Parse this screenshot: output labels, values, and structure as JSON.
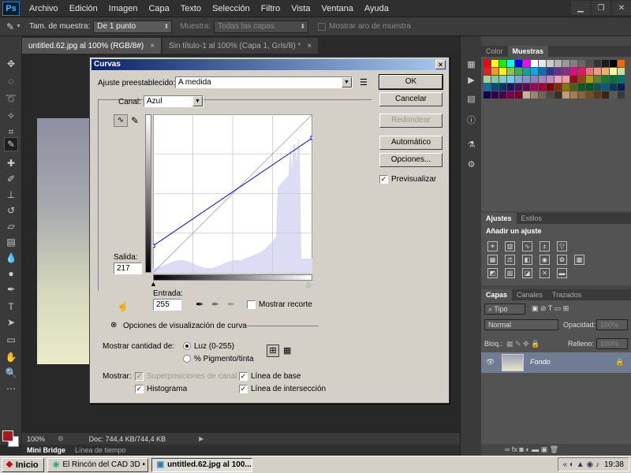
{
  "app": {
    "logo": "Ps"
  },
  "menu": [
    "Archivo",
    "Edición",
    "Imagen",
    "Capa",
    "Texto",
    "Selección",
    "Filtro",
    "Vista",
    "Ventana",
    "Ayuda"
  ],
  "options": {
    "sample_size_label": "Tam. de muestra:",
    "sample_size_value": "De 1 punto",
    "sample_label": "Muestra:",
    "sample_value": "Todas las capas",
    "ring_label": "Mostrar aro de muestra"
  },
  "doc_tabs": [
    {
      "label": "untitled.62.jpg al 100% (RGB/8#)",
      "close": "×"
    },
    {
      "label": "Sin título-1 al 100% (Capa 1, Gris/8) *",
      "close": "×"
    }
  ],
  "status": {
    "zoom": "100%",
    "doc": "Doc: 744,4 KB/744,4 KB"
  },
  "bottom_tabs": [
    "Mini Bridge",
    "Línea de tiempo"
  ],
  "panels": {
    "color_tabs": [
      "Color",
      "Muestras"
    ],
    "adjust_tabs": [
      "Ajustes",
      "Estilos"
    ],
    "adjust_title": "Añadir un ajuste",
    "layer_tabs": [
      "Capas",
      "Canales",
      "Trazados"
    ],
    "kind_filter": "Tipo",
    "blend_mode": "Normal",
    "opacity_label": "Opacidad:",
    "opacity_value": "100%",
    "lock_label": "Bloq.:",
    "fill_label": "Relleno:",
    "fill_value": "100%",
    "layer_name": "Fondo"
  },
  "dialog": {
    "title": "Curvas",
    "close": "×",
    "preset_label": "Ajuste preestablecido:",
    "preset_value": "A medida",
    "channel_label": "Canal:",
    "channel_value": "Azul",
    "output_label": "Salida:",
    "output_value": "217",
    "input_label": "Entrada:",
    "input_value": "255",
    "show_clipping": "Mostrar recorte",
    "display_options": "Opciones de visualización de curva",
    "show_amount_label": "Mostrar cantidad de:",
    "light_option": "Luz (0-255)",
    "pigment_option": "% Pigmento/tinta",
    "show_label": "Mostrar:",
    "channel_overlays": "Superposiciones de canal",
    "histogram": "Histograma",
    "baseline": "Línea de base",
    "intersection": "Línea de intersección",
    "buttons": {
      "ok": "OK",
      "cancel": "Cancelar",
      "smooth": "Redondear",
      "auto": "Automático",
      "options": "Opciones..."
    },
    "preview": "Previsualizar",
    "curve": {
      "channel": "blue",
      "points": [
        [
          0,
          0
        ],
        [
          255,
          217
        ]
      ]
    },
    "accent": "#0000ff"
  },
  "taskbar": {
    "start": "Inicio",
    "items": [
      "El Rincón del CAD 3D • E...",
      "untitled.62.jpg al 100..."
    ],
    "time": "19:38"
  }
}
